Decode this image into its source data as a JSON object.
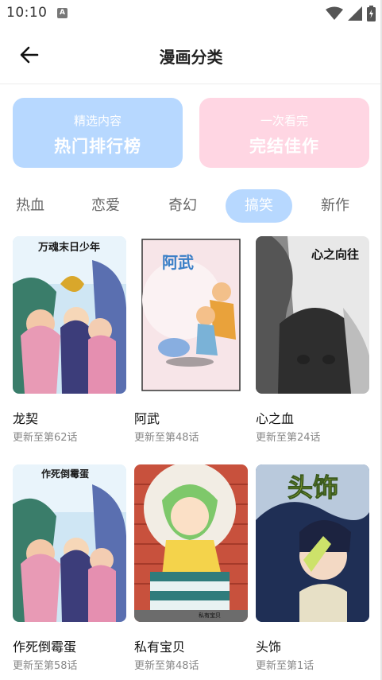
{
  "status_bar": {
    "time": "10:10",
    "notification_letter": "A"
  },
  "header": {
    "title": "漫画分类"
  },
  "banners": [
    {
      "sub": "精选内容",
      "main": "热门排行榜",
      "color": "#b7d8ff"
    },
    {
      "sub": "一次看完",
      "main": "完结佳作",
      "color": "#ffd6e3"
    }
  ],
  "tabs": [
    "热血",
    "恋爱",
    "奇幻",
    "搞笑",
    "新作"
  ],
  "active_tab": "搞笑",
  "comics": [
    {
      "title": "龙契",
      "update": "更新至第62话",
      "cover_text": "万魂末日少年"
    },
    {
      "title": "阿武",
      "update": "更新至第48话",
      "cover_text": "阿武"
    },
    {
      "title": "心之血",
      "update": "更新至第24话",
      "cover_text": "心之向往"
    },
    {
      "title": "作死倒霉蛋",
      "update": "更新至第58话",
      "cover_text": "作死倒霉蛋"
    },
    {
      "title": "私有宝贝",
      "update": "更新至第48话",
      "cover_text": "私有宝贝"
    },
    {
      "title": "头饰",
      "update": "更新至第1话",
      "cover_text": "头饰"
    }
  ]
}
